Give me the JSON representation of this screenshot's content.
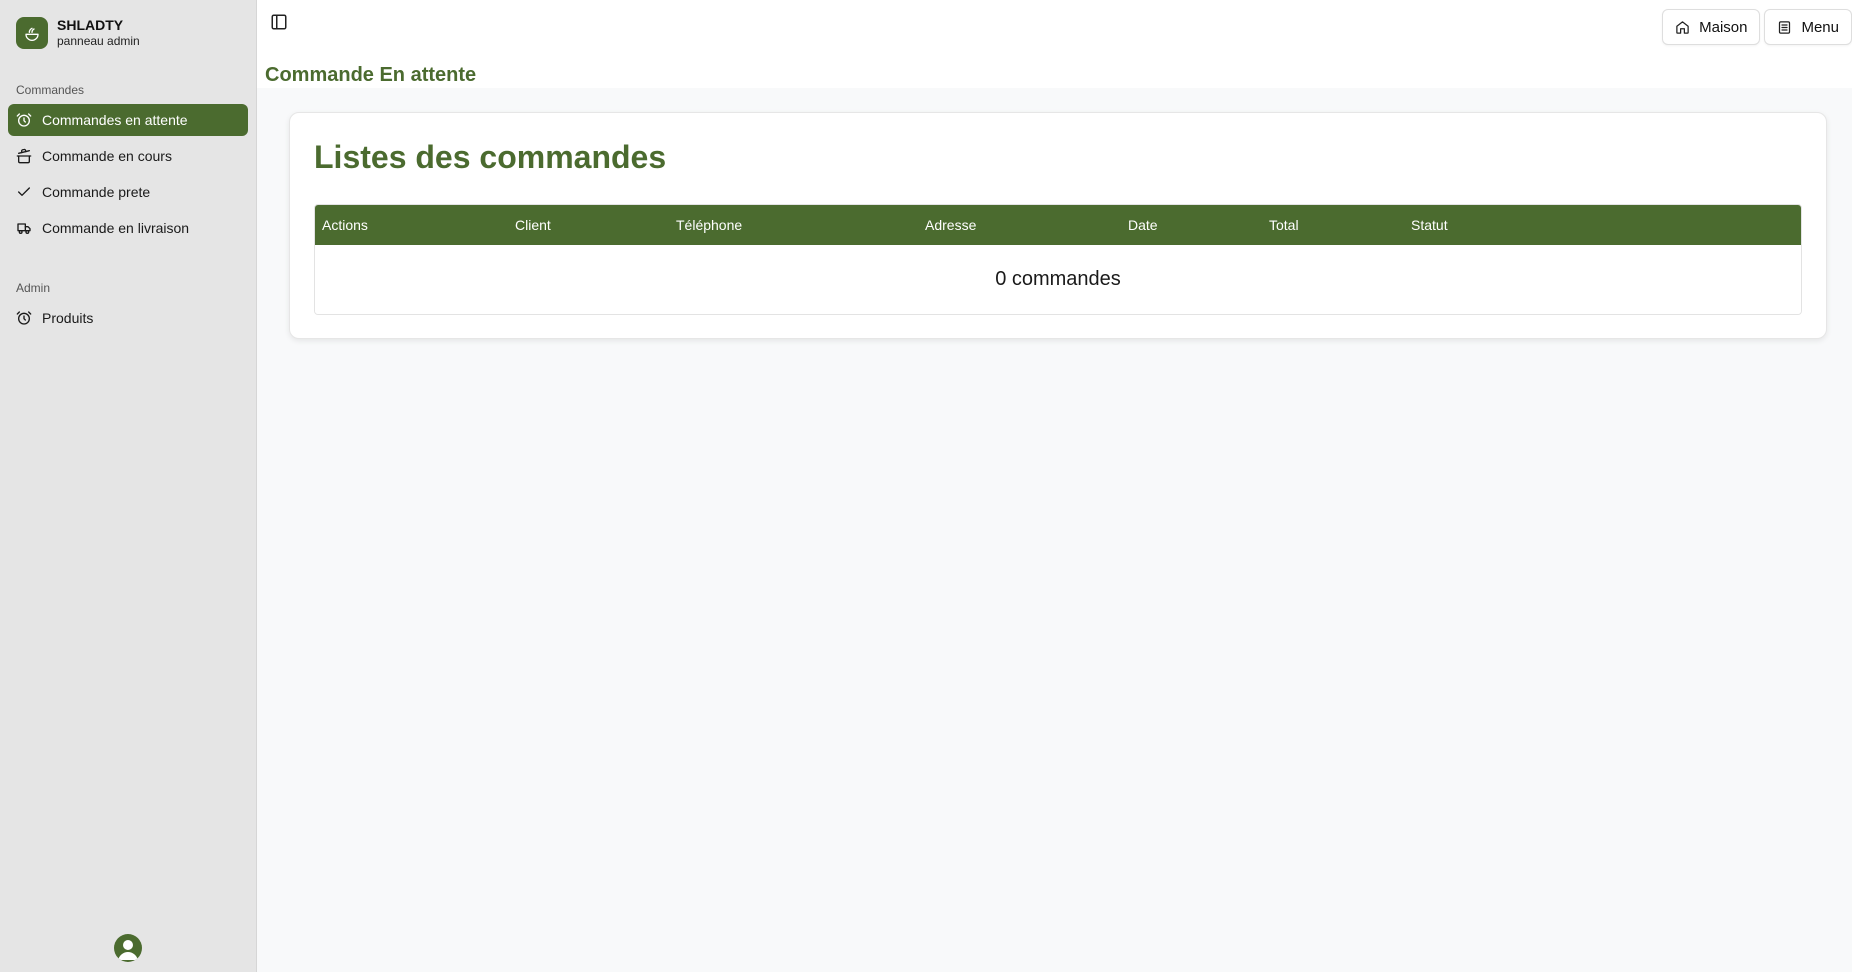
{
  "brand": {
    "name": "SHLADTY",
    "subtitle": "panneau admin"
  },
  "sidebar": {
    "groups": [
      {
        "label": "Commandes",
        "items": [
          {
            "label": "Commandes en attente",
            "icon": "alarm-clock-icon",
            "active": true
          },
          {
            "label": "Commande en cours",
            "icon": "cooking-pot-icon",
            "active": false
          },
          {
            "label": "Commande prete",
            "icon": "check-icon",
            "active": false
          },
          {
            "label": "Commande en livraison",
            "icon": "truck-icon",
            "active": false
          }
        ]
      },
      {
        "label": "Admin",
        "items": [
          {
            "label": "Produits",
            "icon": "alarm-clock-icon",
            "active": false
          }
        ]
      }
    ]
  },
  "topbar": {
    "home_label": "Maison",
    "menu_label": "Menu"
  },
  "page": {
    "title": "Commande En attente"
  },
  "card": {
    "title": "Listes des commandes"
  },
  "table": {
    "columns": [
      "Actions",
      "Client",
      "Téléphone",
      "Adresse",
      "Date",
      "Total",
      "Statut"
    ],
    "empty_text": "0 commandes"
  },
  "colors": {
    "accent": "#4b6b2f",
    "sidebar_bg": "#e5e5e5",
    "content_bg": "#f8f9fa"
  }
}
